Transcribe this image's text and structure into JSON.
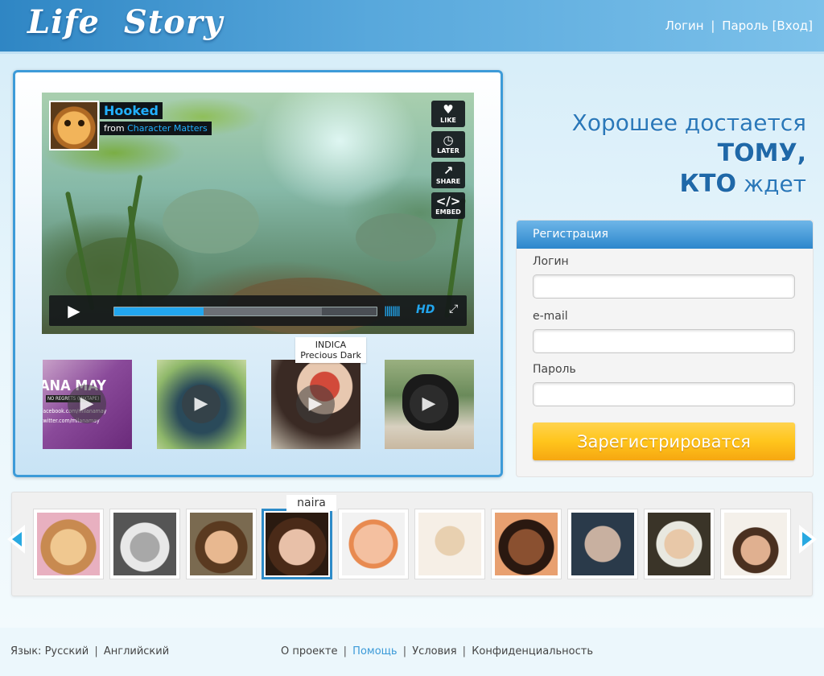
{
  "header": {
    "logo": "Life  Story",
    "login_link": "Логин",
    "password_link": "Пароль",
    "enter_link": "[Вход]",
    "separator": "|"
  },
  "player": {
    "title": "Hooked",
    "from_label": "from",
    "author": "Character Matters",
    "buttons": [
      {
        "label": "LIKE",
        "icon": "heart-icon"
      },
      {
        "label": "LATER",
        "icon": "clock-icon"
      },
      {
        "label": "SHARE",
        "icon": "share-icon"
      },
      {
        "label": "EMBED",
        "icon": "code-icon"
      }
    ],
    "progress_played": 0.34,
    "progress_buffered": 0.79,
    "hd_label": "HD"
  },
  "thumbnails": [
    {
      "name": "ana-may",
      "overlay_text": "ANA MAY",
      "sub_text": "NO REGRETS (MIXTAPE)",
      "lines": [
        "facebook.com/milanamay",
        "twitter.com/milanamay"
      ]
    },
    {
      "name": "blue-leaf"
    },
    {
      "name": "indica-precious-dark",
      "caption_line1": "INDICA",
      "caption_line2": "Precious Dark"
    },
    {
      "name": "black-horse"
    }
  ],
  "slogan": {
    "part1": "Хорошее достается",
    "part2": "ТОМУ,",
    "part3": "КТО",
    "part4": "ждет"
  },
  "registration": {
    "header": "Регистрация",
    "login_label": "Логин",
    "login_value": "",
    "email_label": "e-mail",
    "email_value": "",
    "password_label": "Пароль",
    "password_value": "",
    "submit_label": "Зарегистрироватся"
  },
  "users": {
    "active_caption": "naira",
    "items": [
      "hamster",
      "einstein",
      "girl",
      "naira",
      "baby",
      "woman-light",
      "woman-smile",
      "man-bald",
      "washington",
      "cowgirl"
    ],
    "active_index": 3
  },
  "footer": {
    "language_label": "Язык:",
    "lang_russian": "Русский",
    "lang_english": "Английский",
    "about": "О проекте",
    "help": "Помощь",
    "terms": "Условия",
    "privacy": "Конфиденциальность",
    "separator": "|"
  },
  "colors": {
    "accent": "#2d87cc",
    "link_blue": "#3b9ad8",
    "player_blue": "#22a6ee",
    "button_yellow": "#ffc51c"
  }
}
